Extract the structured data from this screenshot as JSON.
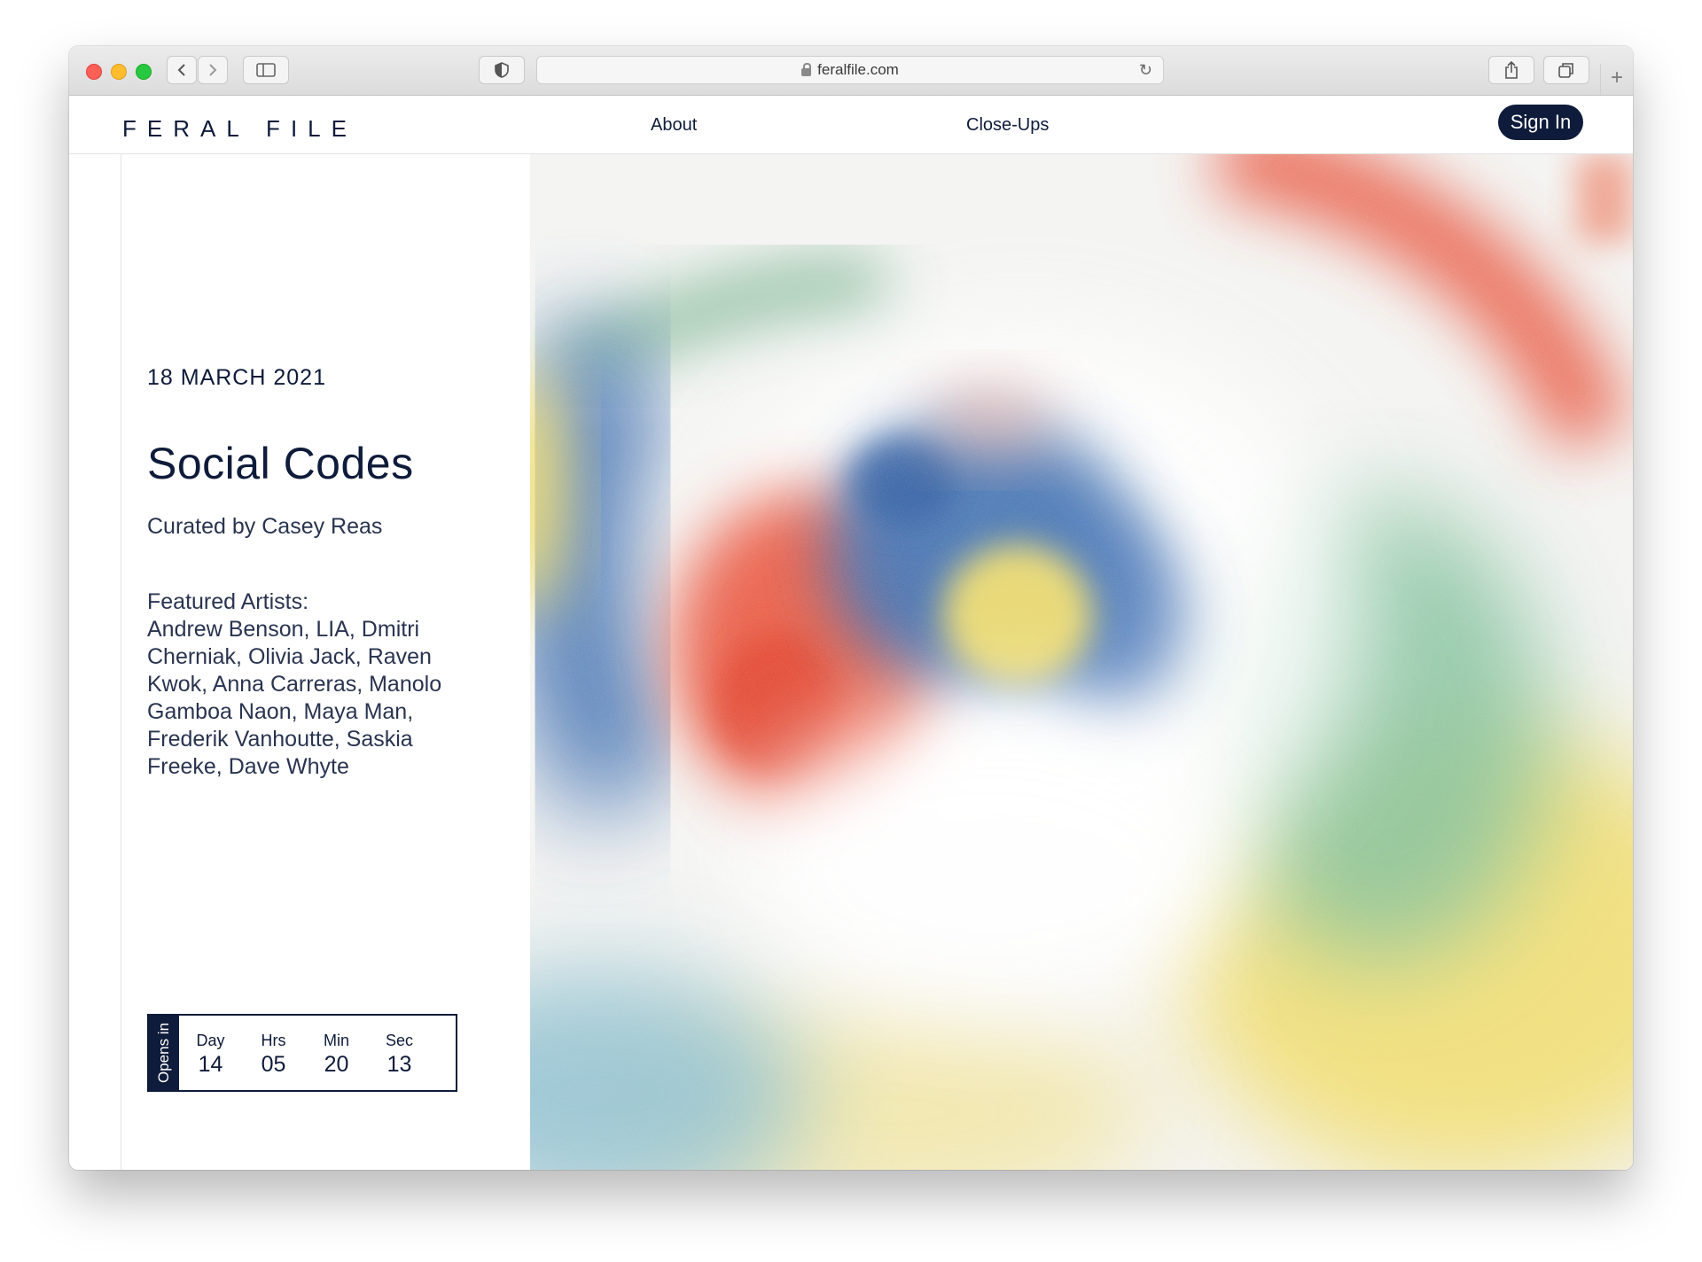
{
  "browser": {
    "url": "feralfile.com"
  },
  "site": {
    "logo": "FERAL FILE",
    "nav": [
      "About",
      "Close-Ups"
    ],
    "signin_label": "Sign In"
  },
  "exhibition": {
    "date": "18 MARCH 2021",
    "title": "Social Codes",
    "curator": "Curated by Casey Reas",
    "featured_heading": "Featured Artists:",
    "artists": "Andrew Benson, LIA, Dmitri Cherniak, Olivia Jack, Raven Kwok, Anna Carreras, Manolo Gamboa Naon, Maya Man, Frederik Vanhoutte, Saskia Freeke, Dave Whyte"
  },
  "countdown": {
    "label": "Opens in",
    "units": [
      {
        "label": "Day",
        "value": "14"
      },
      {
        "label": "Hrs",
        "value": "05"
      },
      {
        "label": "Min",
        "value": "20"
      },
      {
        "label": "Sec",
        "value": "13"
      }
    ]
  },
  "colors": {
    "navy": "#0f1b3a",
    "art_red": "#e8553d",
    "art_blue": "#3f6fb0",
    "art_green": "#7fbf9a",
    "art_yellow": "#f0dc6a"
  }
}
